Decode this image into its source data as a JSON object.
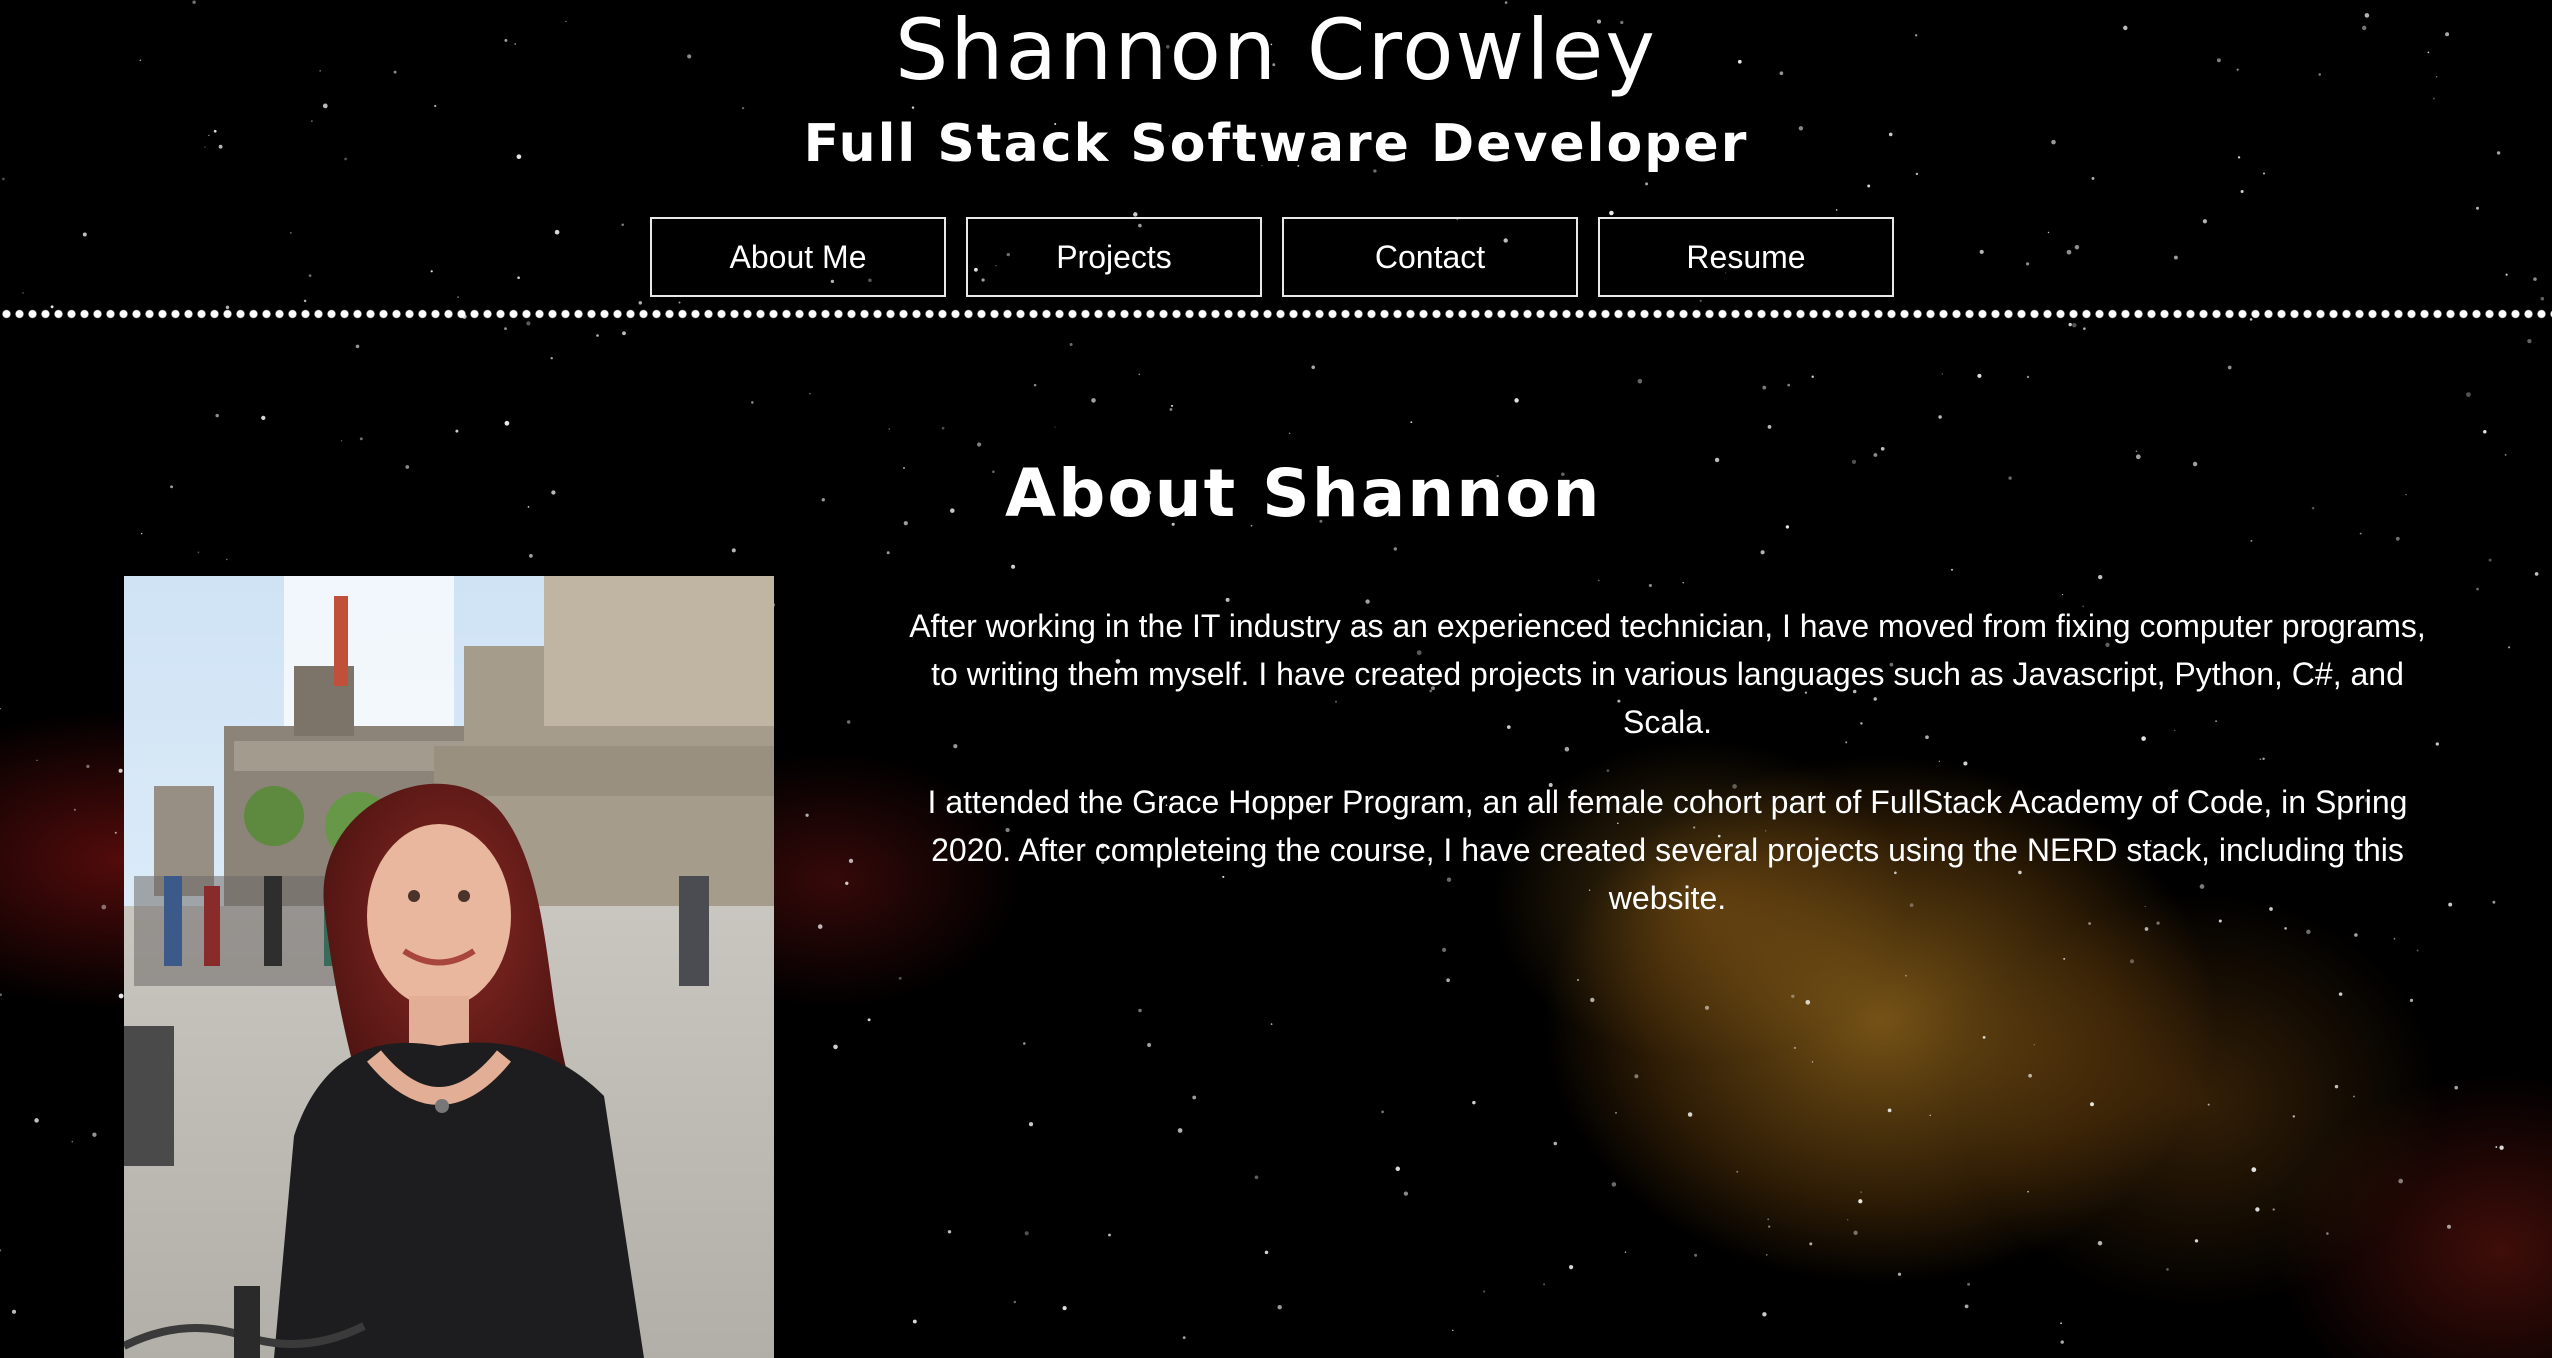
{
  "header": {
    "title": "Shannon Crowley",
    "subtitle": "Full Stack Software Developer"
  },
  "nav": {
    "items": [
      {
        "label": "About Me"
      },
      {
        "label": "Projects"
      },
      {
        "label": "Contact"
      },
      {
        "label": "Resume"
      }
    ]
  },
  "about": {
    "heading": "About Shannon",
    "paragraphs": [
      "After working in the IT industry as an experienced technician, I have moved from fixing computer programs, to writing them myself. I have created projects in various languages such as Javascript, Python, C#, and Scala.",
      "I attended the Grace Hopper Program, an all female cohort part of FullStack Academy of Code, in Spring 2020. After completeing the course, I have created several projects using the NERD stack, including this website."
    ]
  },
  "colors": {
    "background": "#000000",
    "text": "#ffffff",
    "nebula_gold": "#d6962a",
    "nebula_red": "#961414"
  }
}
